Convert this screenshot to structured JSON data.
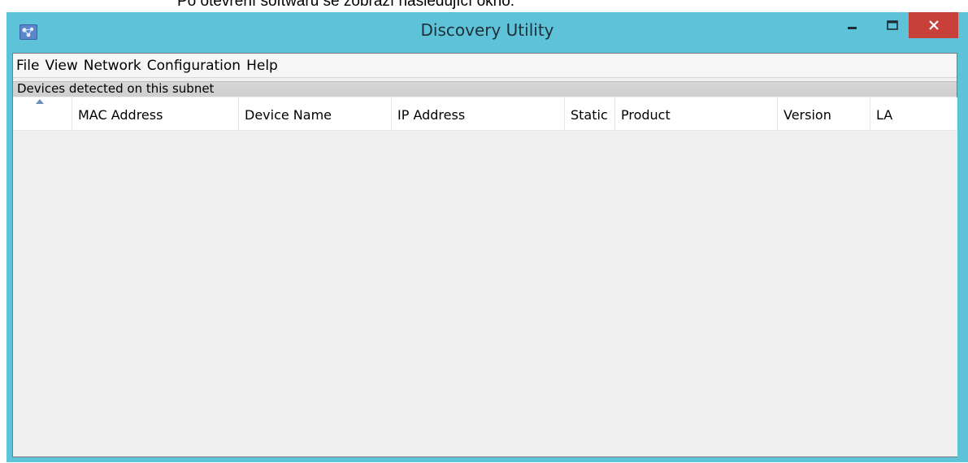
{
  "document": {
    "caption_line": "Po otevření softwaru se zobrazí následující okno:"
  },
  "window": {
    "title": "Discovery Utility",
    "controls": {
      "minimize_icon": "minimize-icon",
      "maximize_icon": "maximize-icon",
      "close_icon": "close-icon"
    },
    "colors": {
      "titlebar": "#5ec3d8",
      "close": "#c8403a"
    }
  },
  "menubar": {
    "items": [
      {
        "label": "File"
      },
      {
        "label": "View"
      },
      {
        "label": "Network"
      },
      {
        "label": "Configuration"
      },
      {
        "label": "Help"
      }
    ]
  },
  "group": {
    "label": "Devices detected on this subnet"
  },
  "table": {
    "sort_indicator": "sort-ascending-icon",
    "columns": [
      {
        "label": ""
      },
      {
        "label": "MAC Address"
      },
      {
        "label": "Device Name"
      },
      {
        "label": "IP Address"
      },
      {
        "label": "Static"
      },
      {
        "label": "Product"
      },
      {
        "label": "Version"
      },
      {
        "label": "LA"
      }
    ],
    "rows": []
  }
}
